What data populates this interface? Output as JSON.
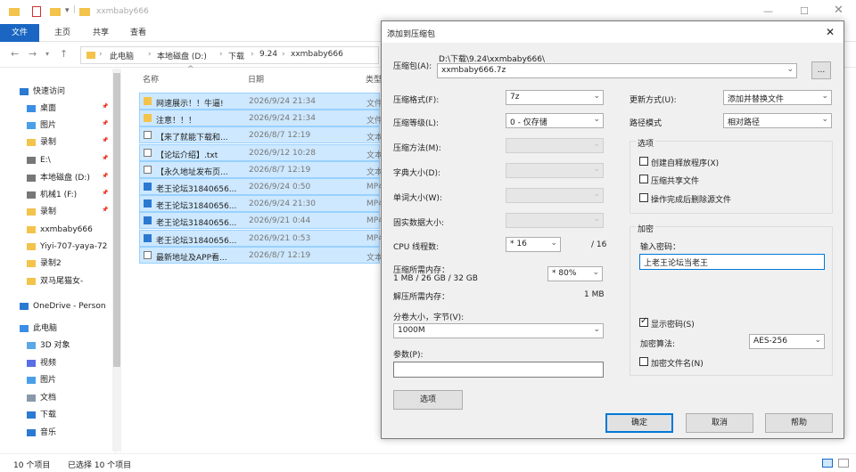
{
  "explorer": {
    "title": "xxmbaby666",
    "ribbon_tabs": [
      "文件",
      "主页",
      "共享",
      "查看"
    ],
    "path": [
      "此电脑",
      "本地磁盘 (D:)",
      "下载",
      "9.24",
      "xxmbaby666"
    ],
    "columns": [
      "名称",
      "日期",
      "类型"
    ],
    "files": [
      {
        "name": "网速展示！！牛逼!",
        "date": "2026/9/24 21:34",
        "type": "文件",
        "icon": "folder"
      },
      {
        "name": "注意！！！",
        "date": "2026/9/24 21:34",
        "type": "文件",
        "icon": "folder"
      },
      {
        "name": "【来了就能下载和...",
        "date": "2026/8/7 12:19",
        "type": "文本",
        "icon": "txt"
      },
      {
        "name": "【论坛介绍】.txt",
        "date": "2026/9/12 10:28",
        "type": "文本",
        "icon": "txt"
      },
      {
        "name": "【永久地址发布页...",
        "date": "2026/8/7 12:19",
        "type": "文本",
        "icon": "txt"
      },
      {
        "name": "老王论坛31840656...",
        "date": "2026/9/24 0:50",
        "type": "MP4",
        "icon": "mp4"
      },
      {
        "name": "老王论坛31840656...",
        "date": "2026/9/24 21:30",
        "type": "MP4",
        "icon": "mp4"
      },
      {
        "name": "老王论坛31840656...",
        "date": "2026/9/21 0:44",
        "type": "MP4",
        "icon": "mp4"
      },
      {
        "name": "老王论坛31840656...",
        "date": "2026/9/21 0:53",
        "type": "MP4",
        "icon": "mp4"
      },
      {
        "name": "最新地址及APP看...",
        "date": "2026/8/7 12:19",
        "type": "文本",
        "icon": "txt"
      }
    ],
    "sidebar": [
      {
        "label": "快速访问",
        "icon": "star-icon",
        "indent": 0
      },
      {
        "label": "桌面",
        "icon": "desktop-icon",
        "indent": 1,
        "pin": true
      },
      {
        "label": "图片",
        "icon": "pictures-icon",
        "indent": 1,
        "pin": true
      },
      {
        "label": "录制",
        "icon": "folder-icon",
        "indent": 1,
        "pin": true
      },
      {
        "label": "E:\\",
        "icon": "drive-icon",
        "indent": 1,
        "pin": true
      },
      {
        "label": "本地磁盘 (D:)",
        "icon": "drive-icon",
        "indent": 1,
        "pin": true
      },
      {
        "label": "机械1 (F:)",
        "icon": "drive-icon",
        "indent": 1,
        "pin": true
      },
      {
        "label": "录制",
        "icon": "folder-icon",
        "indent": 1,
        "pin": true
      },
      {
        "label": "xxmbaby666",
        "icon": "folder-icon",
        "indent": 1
      },
      {
        "label": "Yiyi-707-yaya-72",
        "icon": "folder-icon",
        "indent": 1
      },
      {
        "label": "录制2",
        "icon": "folder-icon",
        "indent": 1
      },
      {
        "label": "双马尾猫女-",
        "icon": "folder-icon",
        "indent": 1
      },
      {
        "label": "OneDrive - Person",
        "icon": "cloud-icon",
        "indent": 0
      },
      {
        "label": "此电脑",
        "icon": "pc-icon",
        "indent": 0
      },
      {
        "label": "3D 对象",
        "icon": "cube-icon",
        "indent": 1
      },
      {
        "label": "视频",
        "icon": "video-icon",
        "indent": 1
      },
      {
        "label": "图片",
        "icon": "pictures-icon",
        "indent": 1
      },
      {
        "label": "文档",
        "icon": "document-icon",
        "indent": 1
      },
      {
        "label": "下载",
        "icon": "download-icon",
        "indent": 1
      },
      {
        "label": "音乐",
        "icon": "music-icon",
        "indent": 1
      }
    ],
    "status": {
      "count": "10 个项目",
      "selected": "已选择 10 个项目"
    }
  },
  "dialog": {
    "title": "添加到压缩包",
    "archive_label": "压缩包(A):",
    "archive_path": "D:\\下载\\9.24\\xxmbaby666\\",
    "archive_name": "xxmbaby666.7z",
    "browse_label": "...",
    "left": [
      {
        "label": "压缩格式(F):",
        "value": "7z",
        "disabled": false
      },
      {
        "label": "压缩等级(L):",
        "value": "0 - 仅存储",
        "disabled": false
      },
      {
        "label": "压缩方法(M):",
        "value": "",
        "disabled": true
      },
      {
        "label": "字典大小(D):",
        "value": "",
        "disabled": true
      },
      {
        "label": "单词大小(W):",
        "value": "",
        "disabled": true
      },
      {
        "label": "固实数据大小:",
        "value": "",
        "disabled": true
      }
    ],
    "cpu_label": "CPU 线程数:",
    "cpu_value": "* 16",
    "cpu_total": "/ 16",
    "mem_label": "压缩所需内存：",
    "mem_detail": "1 MB / 26 GB / 32 GB",
    "mem_value": "* 80%",
    "mem_value2": "1 MB",
    "decomp_label": "解压所需内存：",
    "split_label": "分卷大小，字节(V):",
    "split_value": "1000M",
    "params_label": "参数(P):",
    "params_value": "",
    "options_button": "选项",
    "update_label": "更新方式(U):",
    "update_value": "添加并替换文件",
    "path_label": "路径模式",
    "path_value": "相对路径",
    "options_group": "选项",
    "options": [
      {
        "label": "创建自释放程序(X)",
        "checked": false
      },
      {
        "label": "压缩共享文件",
        "checked": false
      },
      {
        "label": "操作完成后删除源文件",
        "checked": false
      }
    ],
    "encrypt_group": "加密",
    "password_label": "输入密码：",
    "password_value": "上老王论坛当老王",
    "show_password": {
      "label": "显示密码(S)",
      "checked": true
    },
    "method_label": "加密算法:",
    "method_value": "AES-256",
    "encrypt_names": {
      "label": "加密文件名(N)",
      "checked": false
    },
    "ok": "确定",
    "cancel": "取消",
    "help": "帮助"
  },
  "colors": {
    "accent": "#1a66c2",
    "selection": "#cde8ff",
    "folder": "#f3c34b"
  }
}
